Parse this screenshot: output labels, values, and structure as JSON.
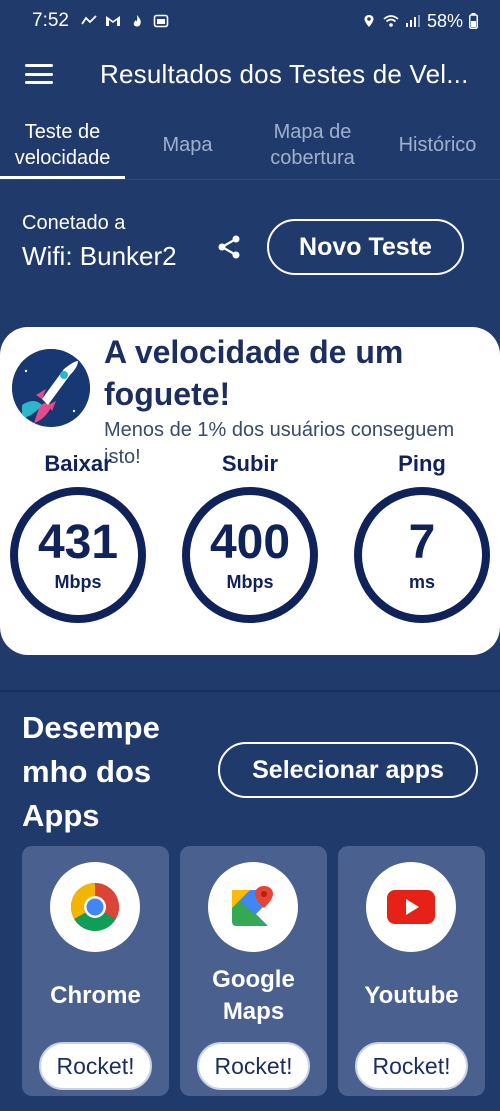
{
  "status_bar": {
    "time": "7:52",
    "battery": "58%"
  },
  "app_bar": {
    "title": "Resultados dos Testes de Vel..."
  },
  "tabs": [
    {
      "label": "Teste de velocidade",
      "active": true
    },
    {
      "label": "Mapa",
      "active": false
    },
    {
      "label": "Mapa de cobertura",
      "active": false
    },
    {
      "label": "Histórico",
      "active": false
    }
  ],
  "connection": {
    "label": "Conetado a",
    "network": "Wifi: Bunker2",
    "new_test_label": "Novo Teste"
  },
  "result": {
    "headline": "A velocidade de um foguete!",
    "subtitle": "Menos de 1% dos usuários conseguem isto!",
    "metrics": [
      {
        "label": "Baixar",
        "value": "431",
        "unit": "Mbps"
      },
      {
        "label": "Subir",
        "value": "400",
        "unit": "Mbps"
      },
      {
        "label": "Ping",
        "value": "7",
        "unit": "ms"
      }
    ]
  },
  "apps_section": {
    "title": "Desempe mho dos Apps",
    "select_label": "Selecionar apps",
    "apps": [
      {
        "name": "Chrome",
        "rating": "Rocket!",
        "icon": "chrome-icon"
      },
      {
        "name": "Google Maps",
        "rating": "Rocket!",
        "icon": "google-maps-icon"
      },
      {
        "name": "Youtube",
        "rating": "Rocket!",
        "icon": "youtube-icon"
      }
    ]
  },
  "colors": {
    "background": "#203a6b",
    "card": "#ffffff",
    "navy": "#10225a",
    "app_card": "#4a6190"
  }
}
